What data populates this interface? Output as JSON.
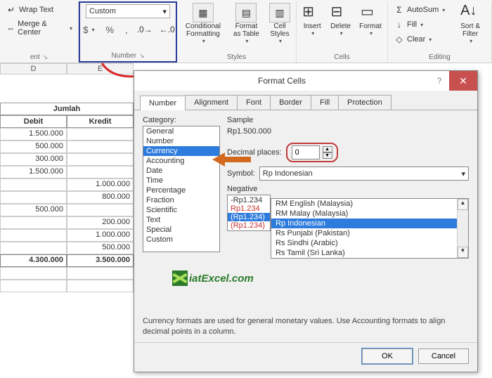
{
  "ribbon": {
    "alignment": {
      "wrap": "Wrap Text",
      "merge": "Merge & Center",
      "group": "ent"
    },
    "number": {
      "format_selected": "Custom",
      "dollar": "$",
      "percent": "%",
      "comma": ",",
      "inc_dec": "←0 .00",
      "dec_dec": ".00 →0",
      "group": "Number"
    },
    "styles": {
      "cond": "Conditional Formatting",
      "table": "Format as Table",
      "cell": "Cell Styles",
      "group": "Styles"
    },
    "cells": {
      "insert": "Insert",
      "delete": "Delete",
      "format": "Format",
      "group": "Cells"
    },
    "editing": {
      "autosum": "AutoSum",
      "fill": "Fill",
      "clear": "Clear",
      "sort": "Sort & Filter",
      "group": "Editing"
    }
  },
  "sheet": {
    "colD": "D",
    "colE": "E",
    "jumlah": "Jumlah",
    "debit": "Debit",
    "kredit": "Kredit",
    "rows": [
      {
        "d": "1.500.000",
        "k": ""
      },
      {
        "d": "500.000",
        "k": ""
      },
      {
        "d": "300.000",
        "k": ""
      },
      {
        "d": "1.500.000",
        "k": ""
      },
      {
        "d": "",
        "k": "1.000.000"
      },
      {
        "d": "",
        "k": "800.000"
      },
      {
        "d": "500.000",
        "k": ""
      },
      {
        "d": "",
        "k": "200.000"
      },
      {
        "d": "",
        "k": "1.000.000"
      },
      {
        "d": "",
        "k": "500.000"
      }
    ],
    "total_d": "4.300.000",
    "total_e": "3.500.000"
  },
  "dialog": {
    "title": "Format Cells",
    "tabs": [
      "Number",
      "Alignment",
      "Font",
      "Border",
      "Fill",
      "Protection"
    ],
    "cat_label": "Category:",
    "categories": [
      "General",
      "Number",
      "Currency",
      "Accounting",
      "Date",
      "Time",
      "Percentage",
      "Fraction",
      "Scientific",
      "Text",
      "Special",
      "Custom"
    ],
    "cat_selected": "Currency",
    "sample_label": "Sample",
    "sample_value": "Rp1.500.000",
    "dec_label": "Decimal places:",
    "dec_value": "0",
    "symbol_label": "Symbol:",
    "symbol_value": "Rp Indonesian",
    "symbol_options": [
      "RM English (Malaysia)",
      "RM Malay (Malaysia)",
      "Rp Indonesian",
      "Rs Punjabi (Pakistan)",
      "Rs Sindhi (Arabic)",
      "Rs Tamil (Sri Lanka)"
    ],
    "symbol_selected": "Rp Indonesian",
    "neg_label": "Negative",
    "neg_items": [
      "-Rp1.234",
      "Rp1.234",
      "(Rp1.234)",
      "(Rp1.234)"
    ],
    "desc": "Currency formats are used for general monetary values.  Use Accounting formats to align decimal points in a column.",
    "ok": "OK",
    "cancel": "Cancel"
  },
  "watermark": "iatExcel.com"
}
